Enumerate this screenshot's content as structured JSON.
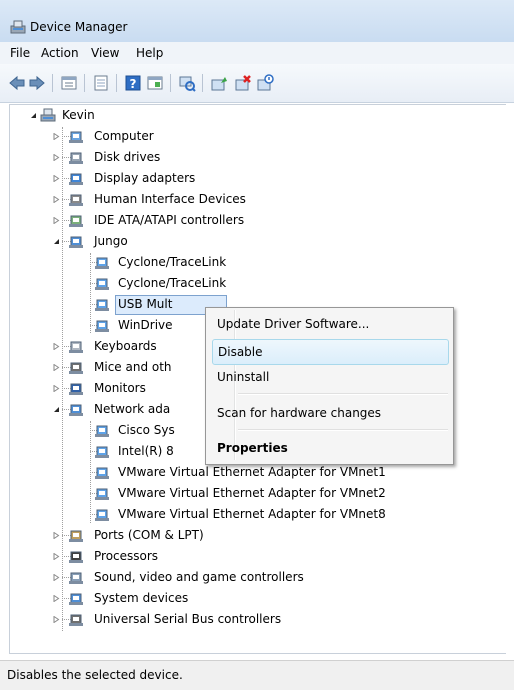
{
  "window": {
    "title": "Device Manager"
  },
  "menu": [
    "File",
    "Action",
    "View",
    "Help"
  ],
  "toolbar": {
    "buttons": [
      "back-icon",
      "forward-icon",
      "up-icon",
      "properties-icon",
      "help-icon",
      "view-icon",
      "scan-icon",
      "update-driver-icon",
      "uninstall-icon",
      "disable-icon"
    ]
  },
  "tree": {
    "root": "Kevin",
    "categories": [
      {
        "label": "Computer",
        "icon": "computer-icon"
      },
      {
        "label": "Disk drives",
        "icon": "disk-icon"
      },
      {
        "label": "Display adapters",
        "icon": "display-icon"
      },
      {
        "label": "Human Interface Devices",
        "icon": "hid-icon"
      },
      {
        "label": "IDE ATA/ATAPI controllers",
        "icon": "ide-icon"
      },
      {
        "label": "Jungo",
        "icon": "jungo-icon",
        "expanded": true
      },
      {
        "label": "Keyboards",
        "icon": "keyboard-icon"
      },
      {
        "label": "Mice and oth",
        "icon": "mouse-icon"
      },
      {
        "label": "Monitors",
        "icon": "monitor-icon"
      },
      {
        "label": "Network ada",
        "icon": "network-icon",
        "expanded": true
      },
      {
        "label": "Ports (COM & LPT)",
        "icon": "port-icon"
      },
      {
        "label": "Processors",
        "icon": "processor-icon"
      },
      {
        "label": "Sound, video and game controllers",
        "icon": "sound-icon"
      },
      {
        "label": "System devices",
        "icon": "system-icon"
      },
      {
        "label": "Universal Serial Bus controllers",
        "icon": "usb-icon"
      }
    ],
    "jungo_children": [
      "Cyclone/TraceLink",
      "Cyclone/TraceLink",
      "USB Mult",
      "WinDrive"
    ],
    "network_children": [
      "Cisco Sys",
      "Intel(R) 8",
      "VMware Virtual Ethernet Adapter for VMnet1",
      "VMware Virtual Ethernet Adapter for VMnet2",
      "VMware Virtual Ethernet Adapter for VMnet8"
    ]
  },
  "context_menu": {
    "items": [
      "Update Driver Software...",
      "Disable",
      "Uninstall",
      "Scan for hardware changes",
      "Properties"
    ]
  },
  "status": "Disables the selected device.",
  "colors": {
    "accent": "#3399ff",
    "menu_hover": "#dbeefb"
  }
}
